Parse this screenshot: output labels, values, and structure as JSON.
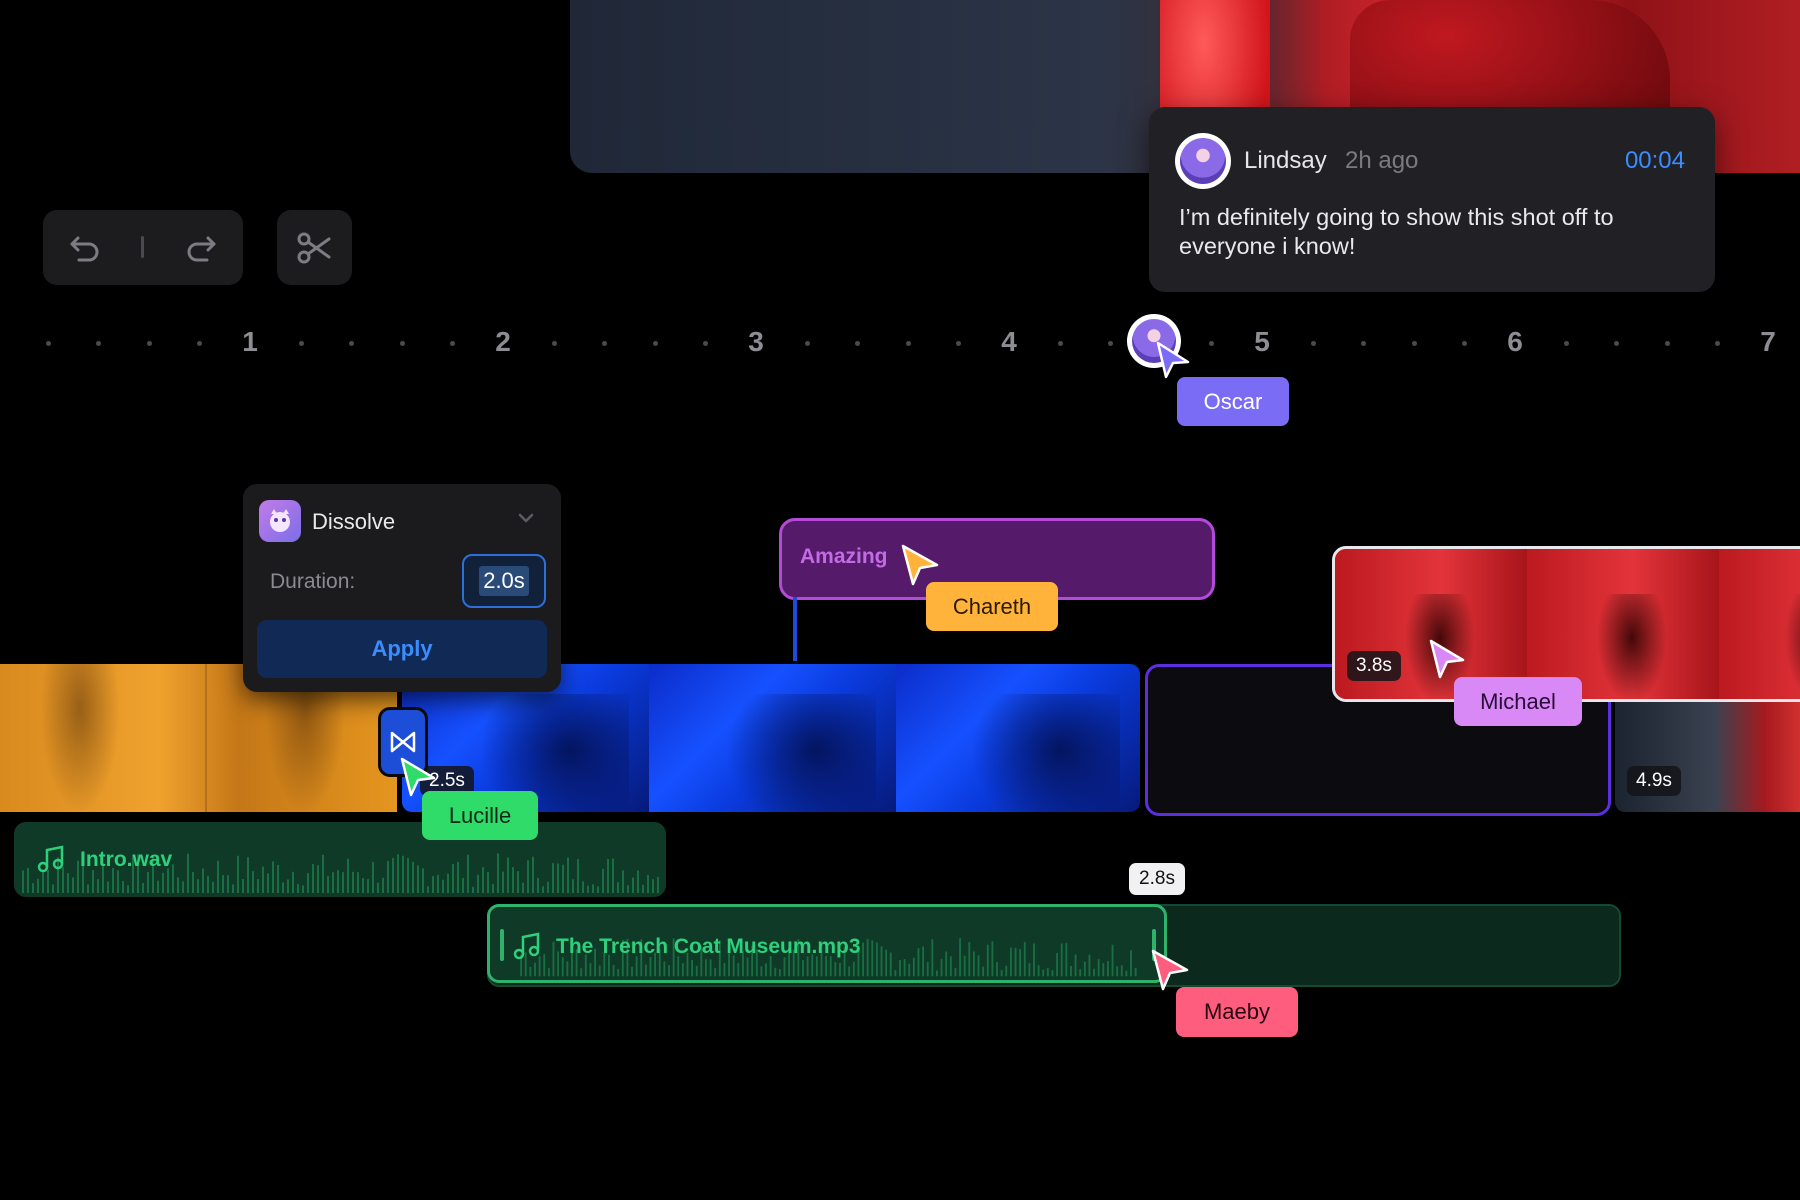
{
  "comment": {
    "author": "Lindsay",
    "time_ago": "2h ago",
    "timestamp": "00:04",
    "text": "I’m definitely going to show this shot off to everyone i know!"
  },
  "toolbar": {
    "undo_icon": "undo-icon",
    "redo_icon": "redo-icon",
    "cut_icon": "scissors-icon"
  },
  "ruler": {
    "ticks": [
      "1",
      "2",
      "3",
      "4",
      "5",
      "6",
      "7"
    ]
  },
  "cursors": {
    "oscar": "Oscar",
    "chareth": "Chareth",
    "michael": "Michael",
    "lucille": "Lucille",
    "maeby": "Maeby"
  },
  "dissolve": {
    "title": "Dissolve",
    "duration_label": "Duration:",
    "duration_value": "2.0s",
    "apply_label": "Apply"
  },
  "marker": {
    "label": "Amazing"
  },
  "clips": {
    "blue_duration": "2.5s",
    "red_duration": "3.8s",
    "last_duration": "4.9s"
  },
  "audio": {
    "track1": "Intro.wav",
    "track2": "The Trench Coat Museum.mp3",
    "trim_time": "2.8s"
  },
  "colors": {
    "accent_blue": "#3b8cff",
    "oscar": "#7b6cf6",
    "chareth": "#ffb33a",
    "michael": "#d889f5",
    "lucille": "#2fdc6a",
    "maeby": "#ff5d7d",
    "audio_green": "#2fd07c",
    "marker_purple": "#b44bd8"
  }
}
